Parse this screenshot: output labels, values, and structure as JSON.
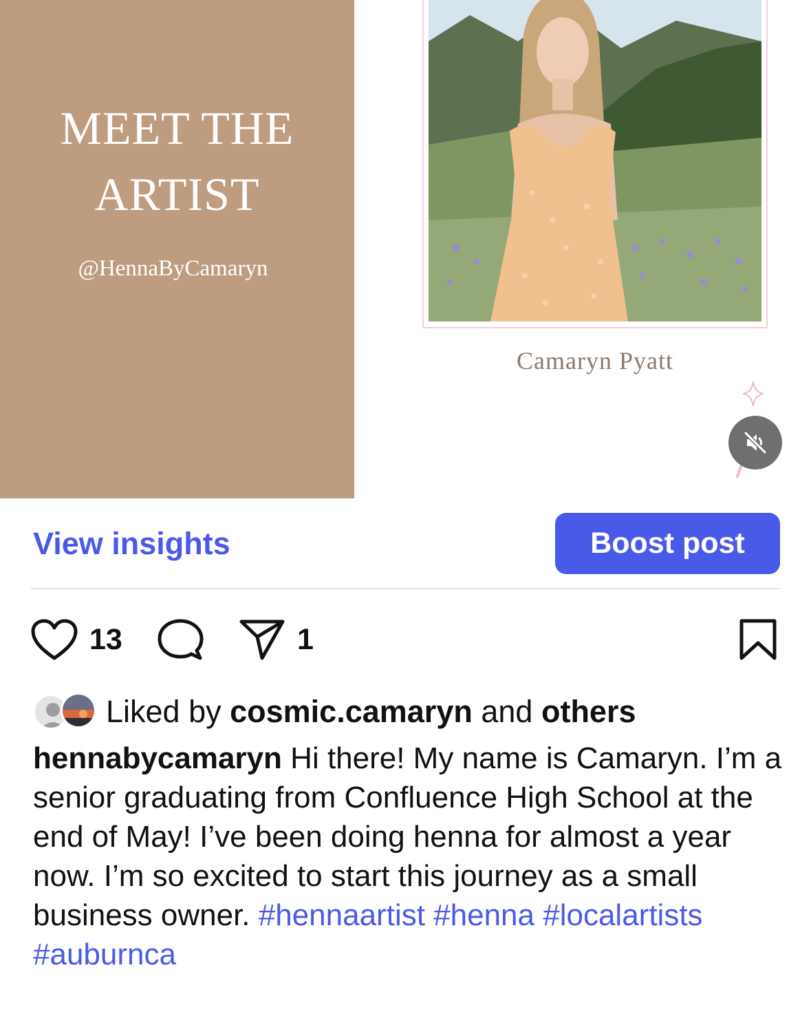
{
  "post_image": {
    "title_line1": "MEET THE",
    "title_line2": "ARTIST",
    "handle": "@HennaByCamaryn",
    "person_name": "Camaryn Pyatt",
    "panel_color": "#bd9c80",
    "mute_icon": "speaker-muted-icon"
  },
  "actions": {
    "view_insights_label": "View insights",
    "boost_label": "Boost post",
    "accent_color": "#4a5ae8"
  },
  "engagement": {
    "like_count": "13",
    "share_count": "1",
    "icons": [
      "heart-icon",
      "comment-icon",
      "share-icon",
      "bookmark-icon"
    ]
  },
  "likes": {
    "prefix": "Liked by",
    "user": "cosmic.camaryn",
    "and": "and",
    "others": "others"
  },
  "caption": {
    "username": "hennabycamaryn",
    "text": "Hi there! My name is Camaryn. I’m a senior graduating from Confluence High School at the end of May! I’ve been doing henna for almost a year now. I’m so excited to start this journey as a small business owner.",
    "hashtags": [
      "#hennaartist",
      "#henna",
      "#localartists",
      "#auburnca"
    ]
  }
}
